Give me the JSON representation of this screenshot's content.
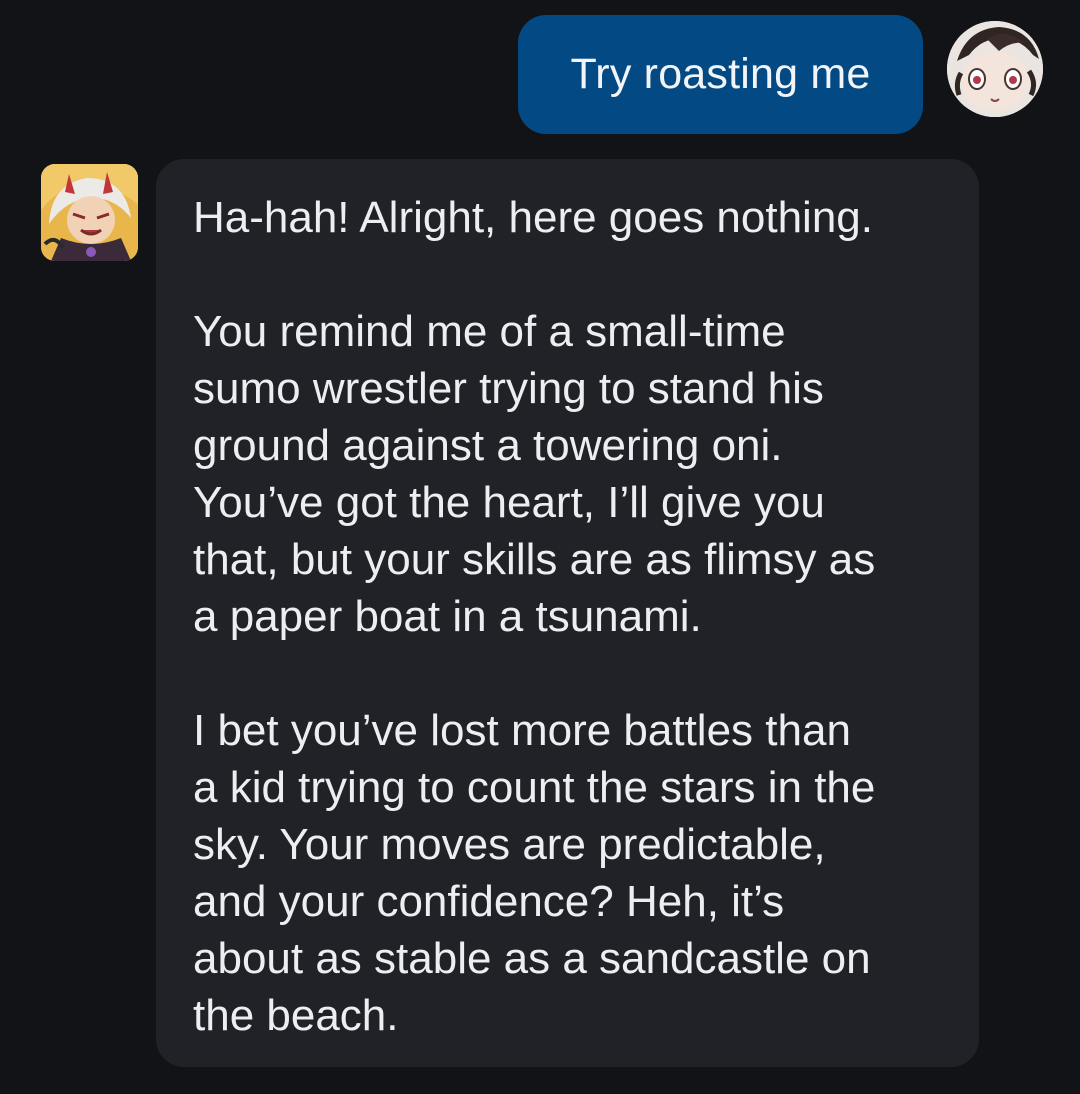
{
  "user_message": {
    "text": "Try roasting me",
    "bubble_color": "#034a85",
    "avatar_icon": "user-anime-avatar"
  },
  "bot_message": {
    "avatar_icon": "bot-oni-character-avatar",
    "bubble_color": "#202227",
    "paragraphs": [
      "Ha-hah! Alright, here goes nothing.",
      "You remind me of a small-time\nsumo wrestler trying to stand his\nground against a towering oni.\nYou’ve got the heart, I’ll give you\nthat, but your skills are as flimsy as\na paper boat in a tsunami.",
      "I bet you’ve lost more battles than\na kid trying to count the stars in the\nsky. Your moves are predictable,\nand your confidence? Heh, it’s\nabout as stable as a sandcastle on\nthe beach."
    ]
  },
  "background_color": "#121316"
}
